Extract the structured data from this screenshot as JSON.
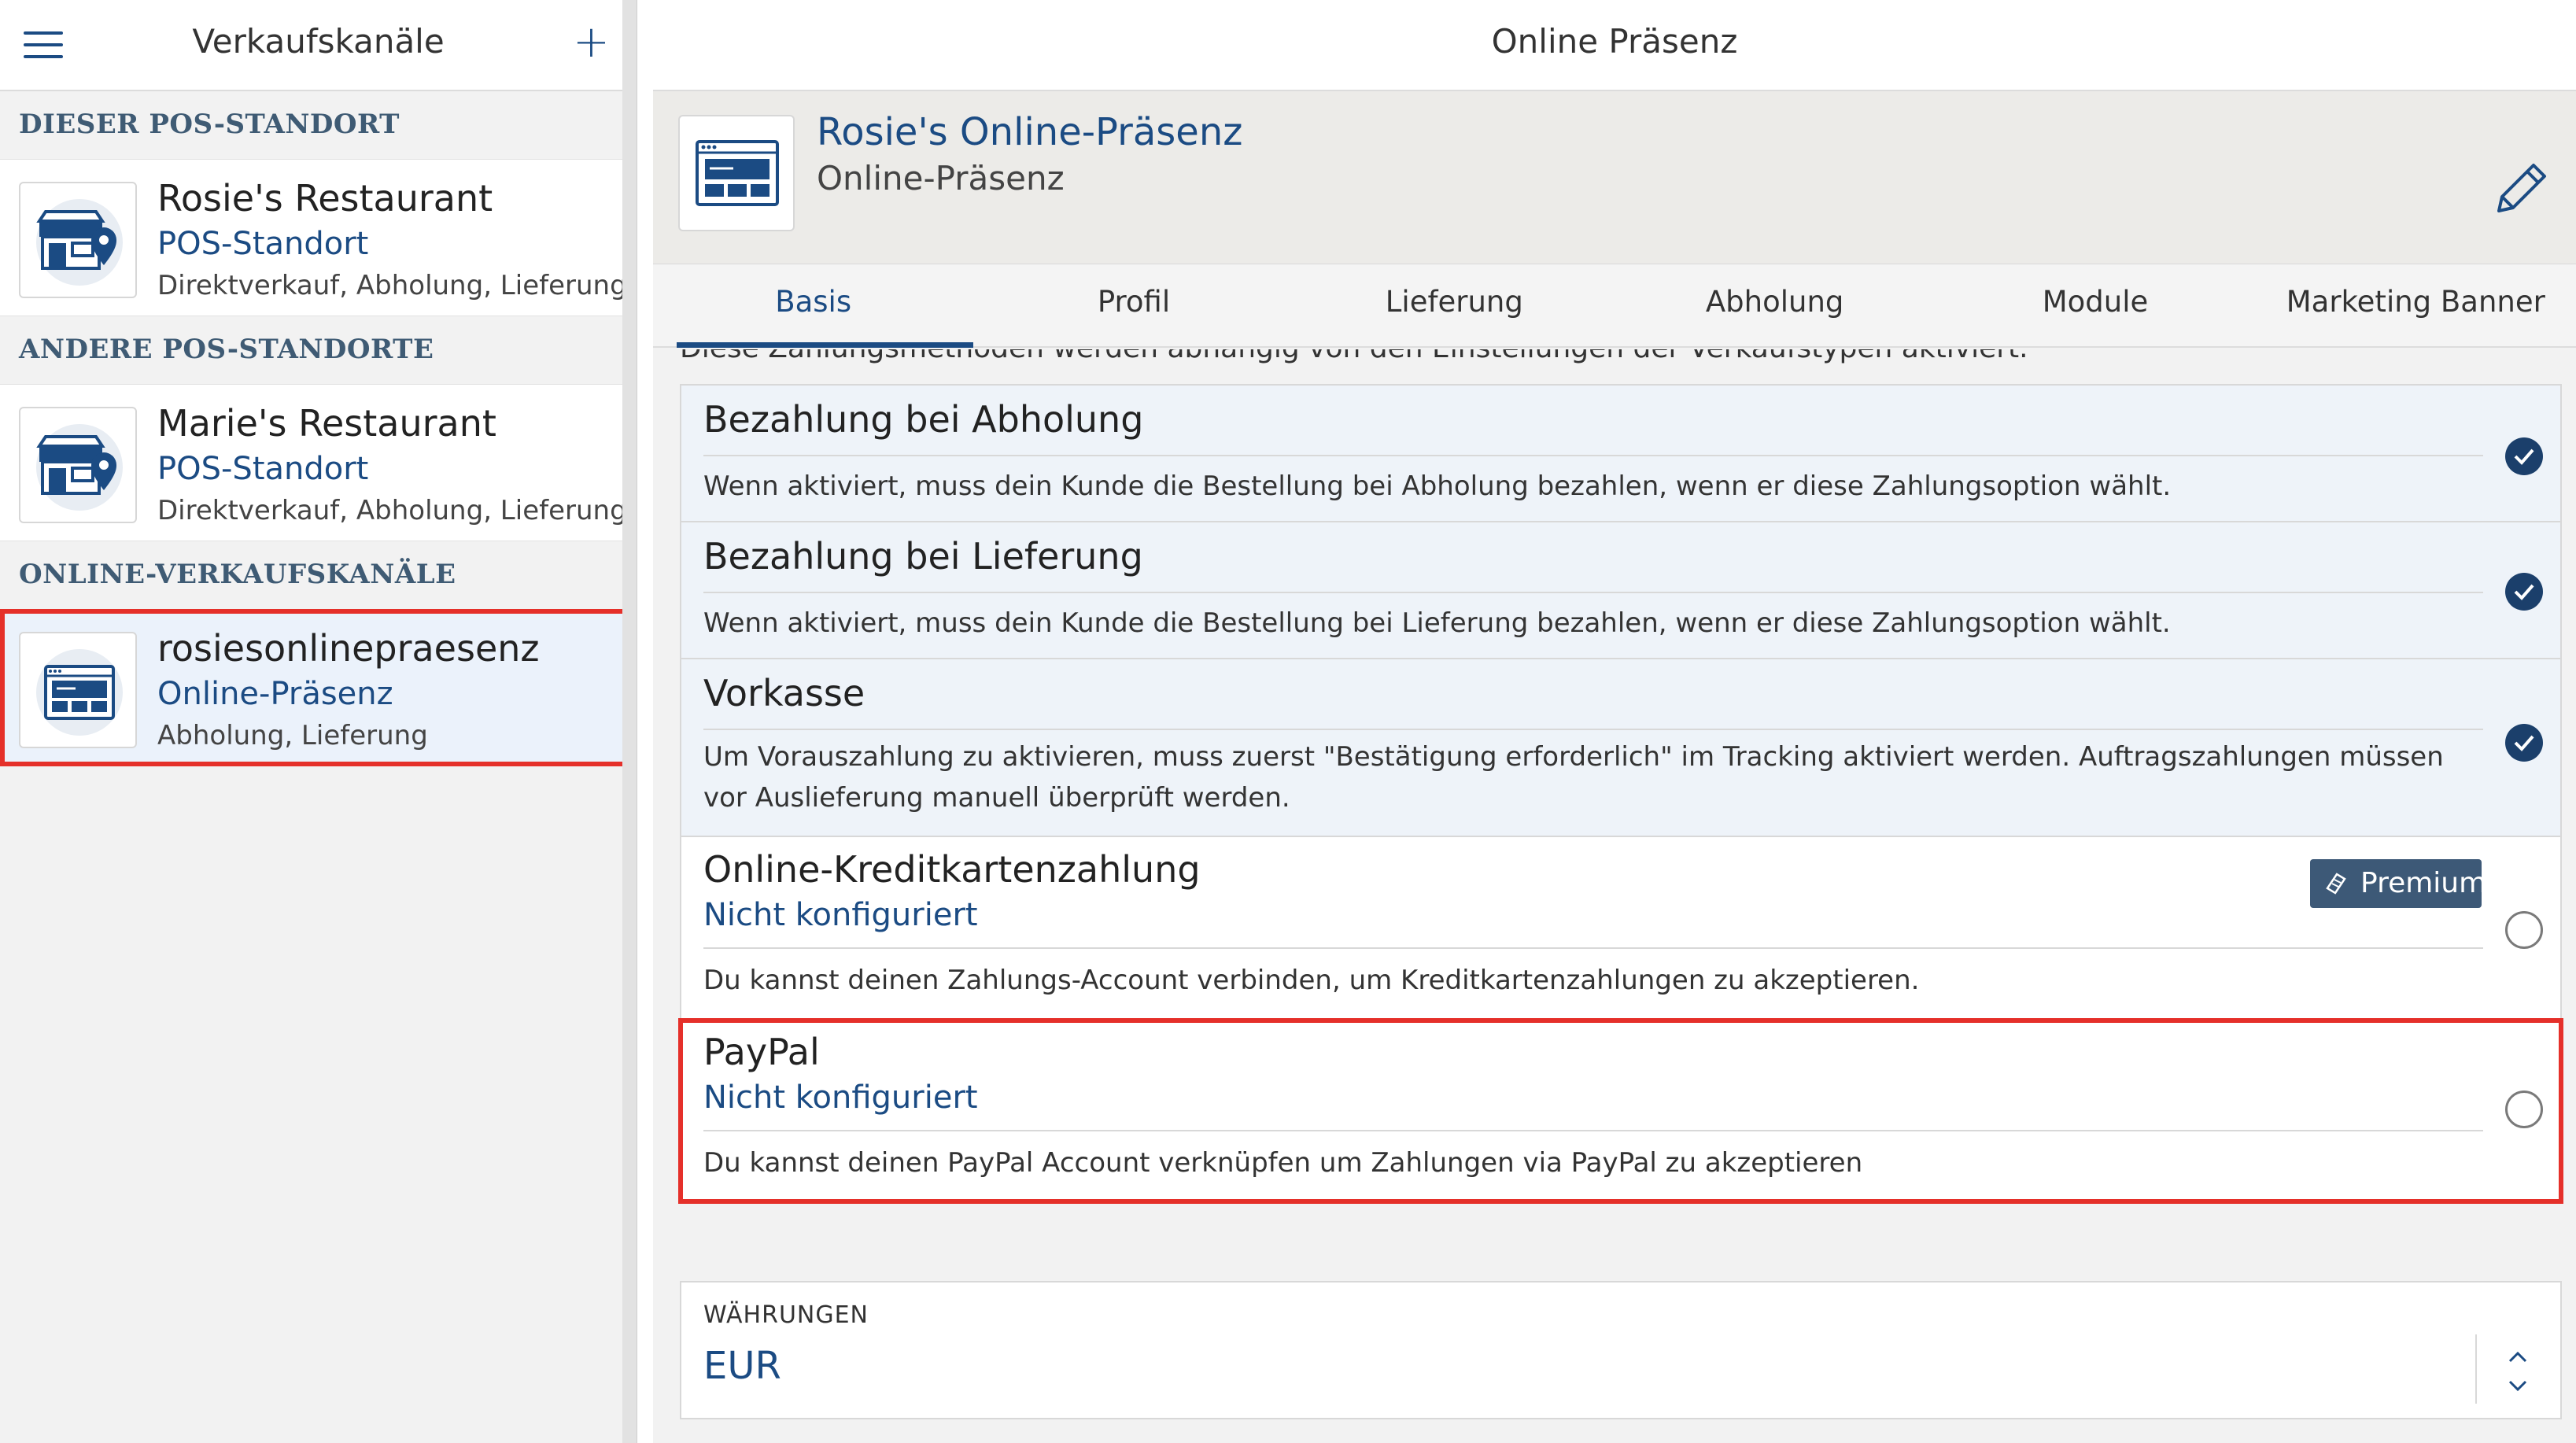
{
  "sidebar": {
    "title": "Verkaufskanäle",
    "sections": [
      {
        "heading": "DIESER POS-STANDORT",
        "items": [
          {
            "name": "Rosie's Restaurant",
            "type": "POS-Standort",
            "modes": "Direktverkauf, Abholung, Lieferung"
          }
        ]
      },
      {
        "heading": "ANDERE POS-STANDORTE",
        "items": [
          {
            "name": "Marie's Restaurant",
            "type": "POS-Standort",
            "modes": "Direktverkauf, Abholung, Lieferung"
          }
        ]
      },
      {
        "heading": "ONLINE-VERKAUFSKANÄLE",
        "items": [
          {
            "name": "rosiesonlinepraesenz",
            "type": "Online-Präsenz",
            "modes": "Abholung, Lieferung"
          }
        ]
      }
    ]
  },
  "main": {
    "header_title": "Online Präsenz",
    "profile": {
      "name": "Rosie's Online-Präsenz",
      "subtitle": "Online-Präsenz"
    },
    "tabs": [
      "Basis",
      "Profil",
      "Lieferung",
      "Abholung",
      "Module",
      "Marketing Banner"
    ],
    "active_tab": "Basis",
    "cut_off_text": "Diese Zahlungsmethoden werden abhängig von den Einstellungen der Verkaufstypen aktiviert.",
    "payments": [
      {
        "title": "Bezahlung bei Abholung",
        "status": "",
        "description": "Wenn aktiviert, muss dein Kunde die Bestellung bei Abholung bezahlen, wenn er diese Zahlungsoption wählt.",
        "enabled": true
      },
      {
        "title": "Bezahlung bei Lieferung",
        "status": "",
        "description": "Wenn aktiviert, muss dein Kunde die Bestellung bei Lieferung bezahlen, wenn er diese Zahlungsoption wählt.",
        "enabled": true
      },
      {
        "title": "Vorkasse",
        "status": "",
        "description": "Um Vorauszahlung zu aktivieren, muss zuerst \"Bestätigung erforderlich\" im Tracking aktiviert werden. Auftragszahlungen müssen vor Auslieferung manuell überprüft werden.",
        "enabled": true
      },
      {
        "title": "Online-Kreditkartenzahlung",
        "status": "Nicht konfiguriert",
        "description": "Du kannst deinen Zahlungs-Account verbinden, um Kreditkartenzahlungen zu akzeptieren.",
        "enabled": false,
        "badge": "Premium"
      },
      {
        "title": "PayPal",
        "status": "Nicht konfiguriert",
        "description": "Du kannst deinen PayPal Account verknüpfen um Zahlungen via PayPal zu akzeptieren",
        "enabled": false
      }
    ],
    "currency": {
      "label": "WÄHRUNGEN",
      "value": "EUR"
    }
  },
  "colors": {
    "accent": "#1b4b83",
    "highlight": "#e5302a",
    "check": "#1b3f6b",
    "premium": "#3d5977"
  }
}
